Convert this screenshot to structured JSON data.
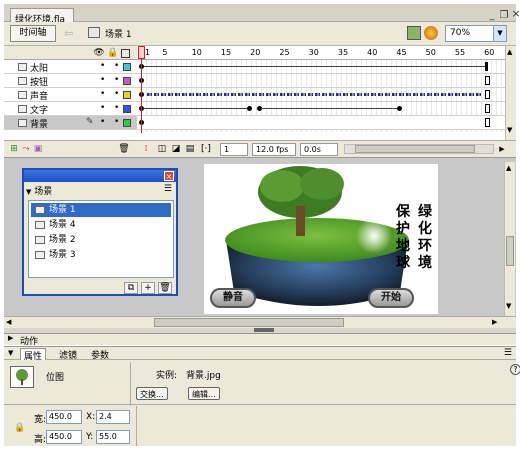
{
  "document": {
    "tab_title": "绿化环境.fla"
  },
  "toolbar": {
    "timeline_button": "时间轴",
    "scene_name": "场景 1",
    "zoom": "70%"
  },
  "timeline": {
    "frame_ticks": [
      "1",
      "5",
      "10",
      "15",
      "20",
      "25",
      "30",
      "35",
      "40",
      "45",
      "50",
      "55",
      "60"
    ],
    "layers": [
      {
        "name": "太阳",
        "color": "#37c8d0",
        "selected": false
      },
      {
        "name": "按钮",
        "color": "#c858d0",
        "selected": false
      },
      {
        "name": "声音",
        "color": "#e8d420",
        "selected": false
      },
      {
        "name": "文字",
        "color": "#3850e8",
        "selected": false
      },
      {
        "name": "背景",
        "color": "#30c840",
        "selected": true
      }
    ],
    "current_frame": "1",
    "fps": "12.0 fps",
    "time": "0.0s"
  },
  "scene_panel": {
    "header": "场景",
    "items": [
      "场景 1",
      "场景 4",
      "场景 2",
      "场景 3"
    ],
    "selected_index": 0
  },
  "stage": {
    "poem_col_left": "保护地球",
    "poem_col_right": "绿化环境",
    "mute_button": "静音",
    "start_button": "开始"
  },
  "panels": {
    "actions_label": "动作",
    "tabs": [
      "属性",
      "滤镜",
      "参数"
    ]
  },
  "properties": {
    "type_label": "位图",
    "instance_label": "实例:",
    "instance_value": "背景.jpg",
    "swap_button": "交换...",
    "edit_button": "编辑...",
    "width_label": "宽:",
    "width_value": "450.0",
    "height_label": "高:",
    "height_value": "450.0",
    "x_label": "X:",
    "x_value": "2.4",
    "y_label": "Y:",
    "y_value": "55.0"
  }
}
